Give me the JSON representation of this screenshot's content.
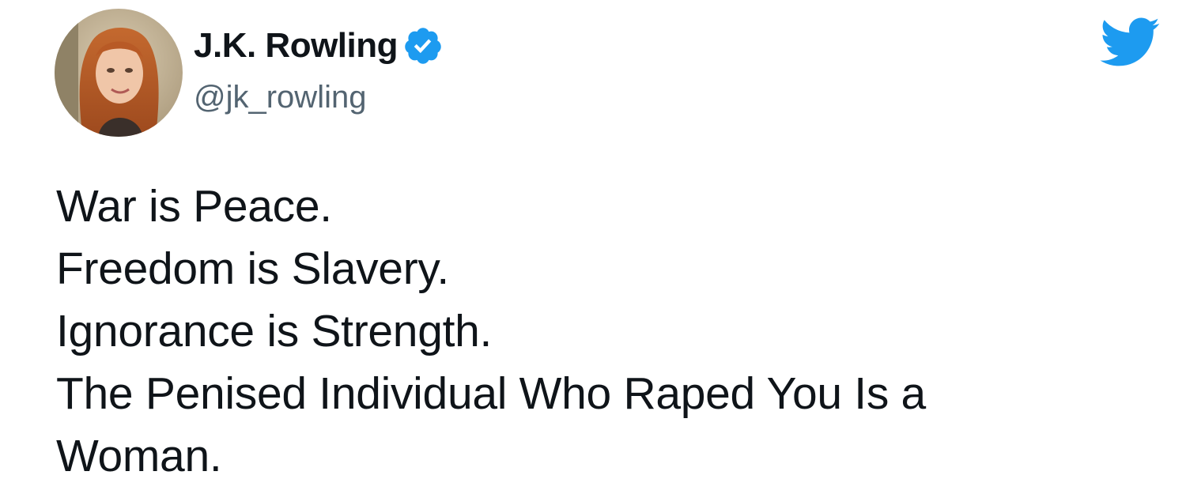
{
  "author": {
    "display_name": "J.K. Rowling",
    "handle": "@jk_rowling",
    "verified": true,
    "avatar_icon": "profile-photo",
    "verified_icon": "verified-badge-icon"
  },
  "brand": {
    "icon": "twitter-bird-icon",
    "color": "#1d9bf0"
  },
  "tweet": {
    "lines": [
      "War is Peace.",
      "Freedom is Slavery.",
      "Ignorance is Strength.",
      "The Penised Individual Who Raped You Is a",
      "Woman."
    ]
  },
  "colors": {
    "text": "#0f1419",
    "handle": "#536471",
    "verified": "#1d9bf0",
    "background": "#ffffff"
  }
}
